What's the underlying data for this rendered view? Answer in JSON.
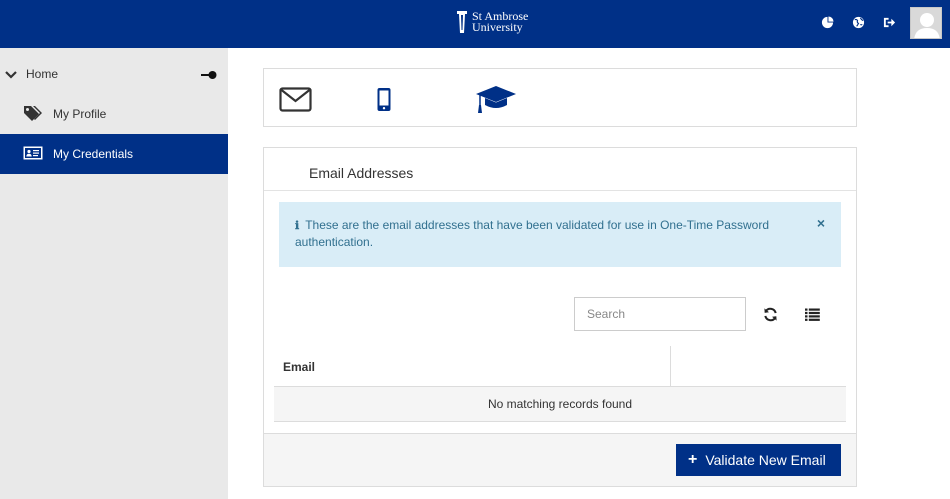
{
  "header": {
    "logo_line1": "St Ambrose",
    "logo_line2": "University",
    "icons": [
      "pie-chart-icon",
      "globe-icon",
      "sign-out-icon"
    ],
    "brand_color": "#003087"
  },
  "sidebar": {
    "home_label": "Home",
    "items": [
      {
        "label": "My Profile",
        "icon": "tags-icon",
        "active": false
      },
      {
        "label": "My Credentials",
        "icon": "id-card-icon",
        "active": true
      }
    ]
  },
  "credential_tabs": [
    "envelope-icon",
    "mobile-icon",
    "graduation-cap-icon"
  ],
  "panel": {
    "title": "Email Addresses",
    "alert_text": "These are the email addresses that have been validated for use in One-Time Password authentication.",
    "alert_close": "×",
    "alert_color": "#d9edf7",
    "search_placeholder": "Search",
    "table": {
      "columns": [
        "Email",
        ""
      ],
      "empty_text": "No matching records found"
    },
    "validate_button": "Validate New Email"
  }
}
